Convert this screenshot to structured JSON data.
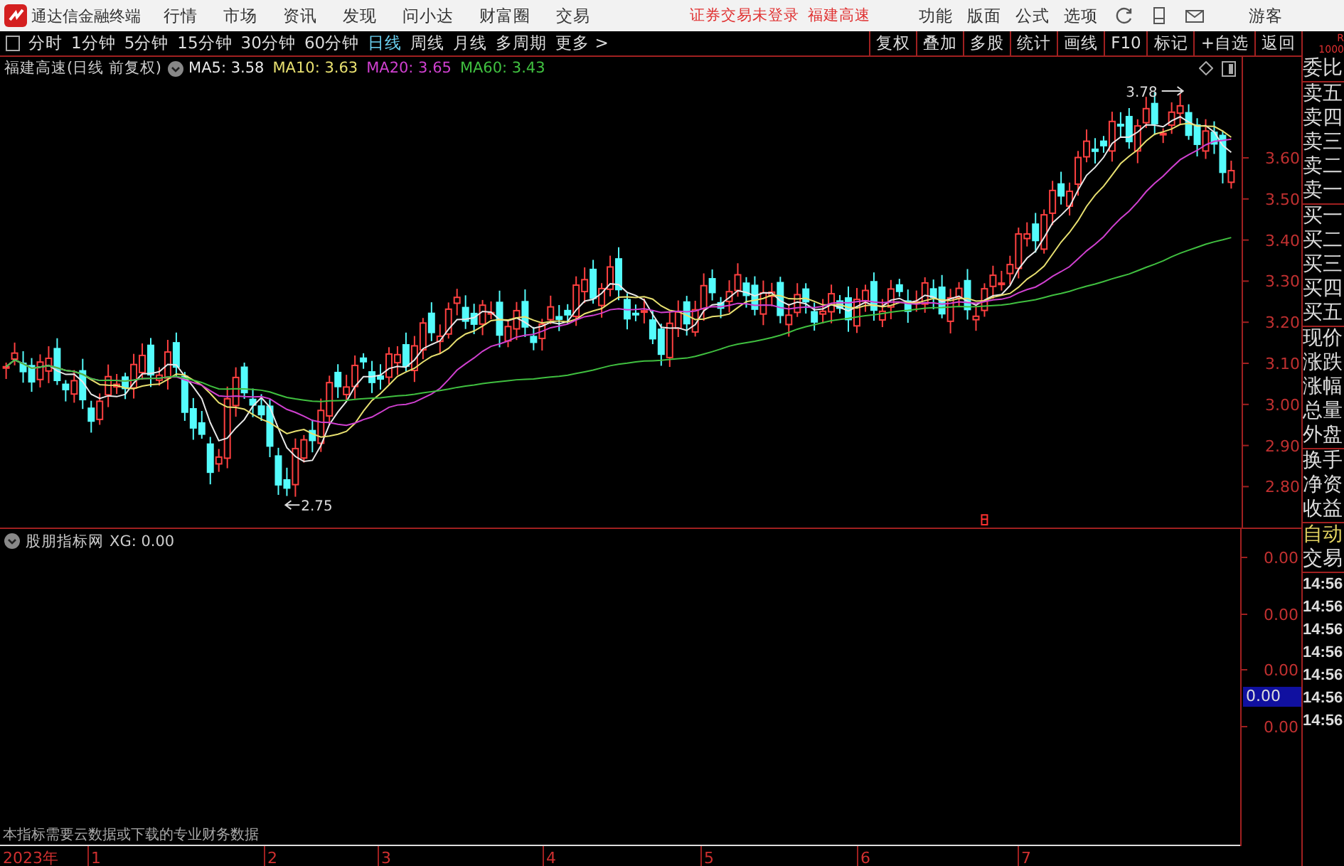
{
  "app": {
    "title": "通达信金融终端",
    "menu": [
      "行情",
      "市场",
      "资讯",
      "发现",
      "问小达",
      "财富圈",
      "交易"
    ],
    "login_status": "证券交易未登录",
    "stock_link": "福建高速",
    "right_menu": [
      "功能",
      "版面",
      "公式",
      "选项"
    ],
    "user": "游客"
  },
  "period_tabs": [
    {
      "label": "分时",
      "selected": false
    },
    {
      "label": "1分钟",
      "selected": false
    },
    {
      "label": "5分钟",
      "selected": false
    },
    {
      "label": "15分钟",
      "selected": false
    },
    {
      "label": "30分钟",
      "selected": false
    },
    {
      "label": "60分钟",
      "selected": false
    },
    {
      "label": "日线",
      "selected": true
    },
    {
      "label": "周线",
      "selected": false
    },
    {
      "label": "月线",
      "selected": false
    },
    {
      "label": "多周期",
      "selected": false
    },
    {
      "label": "更多 >",
      "selected": false
    }
  ],
  "tool_buttons": [
    "复权",
    "叠加",
    "多股",
    "统计",
    "画线",
    "F10",
    "标记",
    "+自选",
    "返回"
  ],
  "main_chart": {
    "title": "福建高速(日线 前复权)",
    "ma_legend": [
      {
        "label": "MA5: 3.58",
        "color": "#e8e8e8"
      },
      {
        "label": "MA10: 3.63",
        "color": "#e8e070"
      },
      {
        "label": "MA20: 3.65",
        "color": "#d040d0"
      },
      {
        "label": "MA60: 3.43",
        "color": "#40c040"
      }
    ],
    "high_note": "3.78",
    "low_note": "2.75",
    "price_ticks": [
      "3.60",
      "3.50",
      "3.40",
      "3.30",
      "3.20",
      "3.10",
      "3.00",
      "2.90",
      "2.80"
    ]
  },
  "indicator": {
    "title": "股朋指标网",
    "value": "XG: 0.00",
    "ticks": [
      "0.00",
      "0.00",
      "0.00",
      "0.00"
    ],
    "cursor_value": "0.00",
    "notice": "本指标需要云数据或下载的专业财务数据"
  },
  "time_axis": [
    "2023年",
    "1",
    "2",
    "3",
    "4",
    "5",
    "6",
    "7"
  ],
  "side_panel": {
    "corner": [
      "R",
      "1000"
    ],
    "groups": [
      [
        "委比"
      ],
      [
        "卖五",
        "卖四",
        "卖三",
        "卖二",
        "卖一"
      ],
      [
        "买一",
        "买二",
        "买三",
        "买四",
        "买五"
      ],
      [
        "现价",
        "涨跌",
        "涨幅",
        "总量",
        "外盘"
      ],
      [
        "换手",
        "净资",
        "收益"
      ]
    ],
    "mode": "自动",
    "trade": "交易",
    "times": [
      "14:56",
      "14:56",
      "14:56",
      "14:56",
      "14:56",
      "14:56",
      "14:56"
    ]
  }
}
